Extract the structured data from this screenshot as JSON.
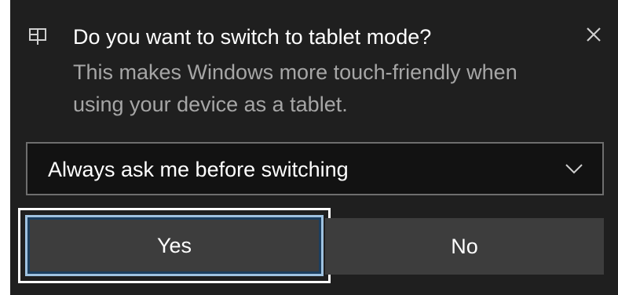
{
  "toast": {
    "title": "Do you want to switch to tablet mode?",
    "body": "This makes Windows more touch-friendly when using your device as a tablet.",
    "app_icon": "tablet-mode-icon",
    "close_icon": "close-icon"
  },
  "dropdown": {
    "selected": "Always ask me before switching",
    "icon": "chevron-down-icon"
  },
  "buttons": {
    "yes_label": "Yes",
    "no_label": "No"
  },
  "colors": {
    "background": "#1f1f1f",
    "title_text": "#ffffff",
    "body_text": "#a6a6a6",
    "button_bg": "#3d3d3d",
    "focus_outer": "#ffffff",
    "focus_inner": "#9fc2e0"
  }
}
